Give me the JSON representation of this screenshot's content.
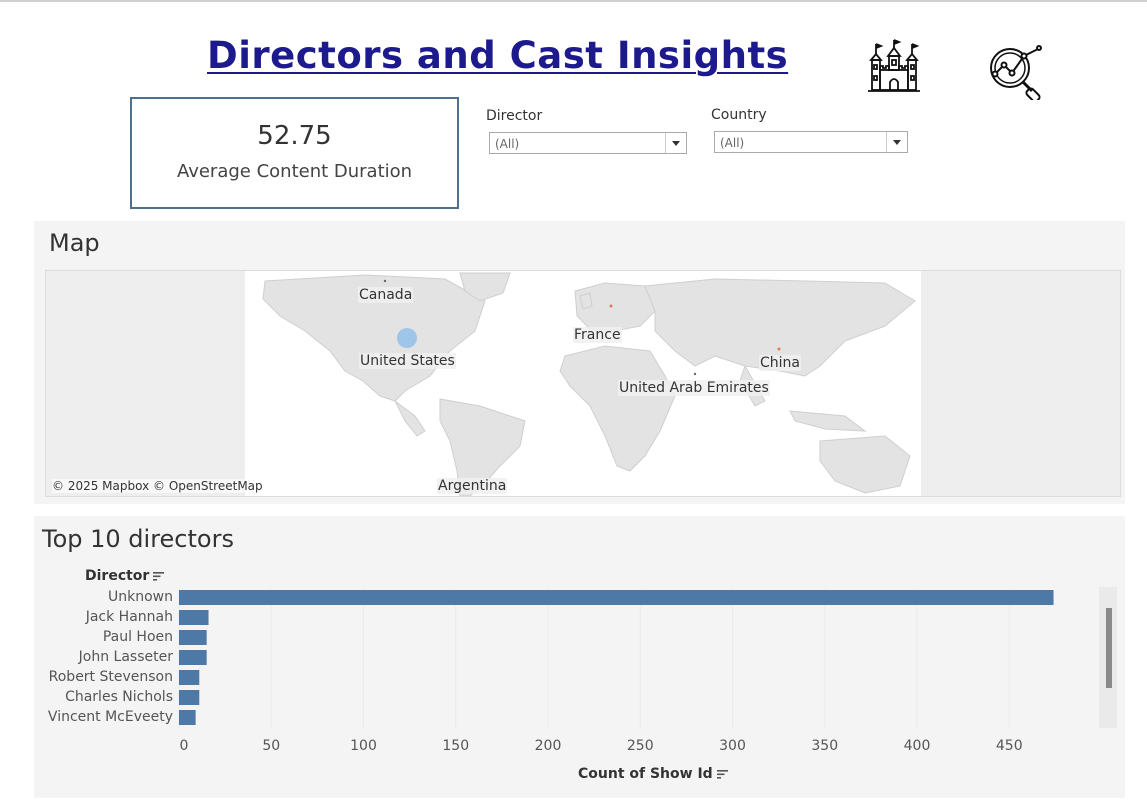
{
  "dashboard": {
    "title": "Directors and Cast Insights",
    "icons": [
      "castle-icon",
      "analytics-magnifier-icon"
    ]
  },
  "kpi": {
    "value": "52.75",
    "label": "Average Content Duration"
  },
  "filters": {
    "director": {
      "label": "Director",
      "value": "(All)"
    },
    "country": {
      "label": "Country",
      "value": "(All)"
    }
  },
  "map_panel": {
    "title": "Map",
    "labels": {
      "canada": "Canada",
      "united_states": "United States",
      "france": "France",
      "china": "China",
      "uae": "United Arab Emirates",
      "argentina": "Argentina"
    },
    "copyright": "© 2025 Mapbox © OpenStreetMap",
    "highlight_color": "#9fc5e8"
  },
  "directors_panel": {
    "title": "Top 10 directors",
    "y_axis_title": "Director",
    "x_axis_title": "Count of Show Id",
    "bar_color": "#4e79a7"
  },
  "chart_data": {
    "type": "bar",
    "orientation": "horizontal",
    "title": "Top 10 directors",
    "ylabel": "Director",
    "xlabel": "Count of Show Id",
    "categories": [
      "Unknown",
      "Jack Hannah",
      "Paul Hoen",
      "John Lasseter",
      "Robert Stevenson",
      "Charles Nichols",
      "Vincent McEveety"
    ],
    "values": [
      474,
      16,
      15,
      15,
      11,
      11,
      9
    ],
    "xticks": [
      "0",
      "50",
      "100",
      "150",
      "200",
      "250",
      "300",
      "350",
      "400",
      "450"
    ],
    "xlim": [
      0,
      500
    ],
    "grid": false
  }
}
